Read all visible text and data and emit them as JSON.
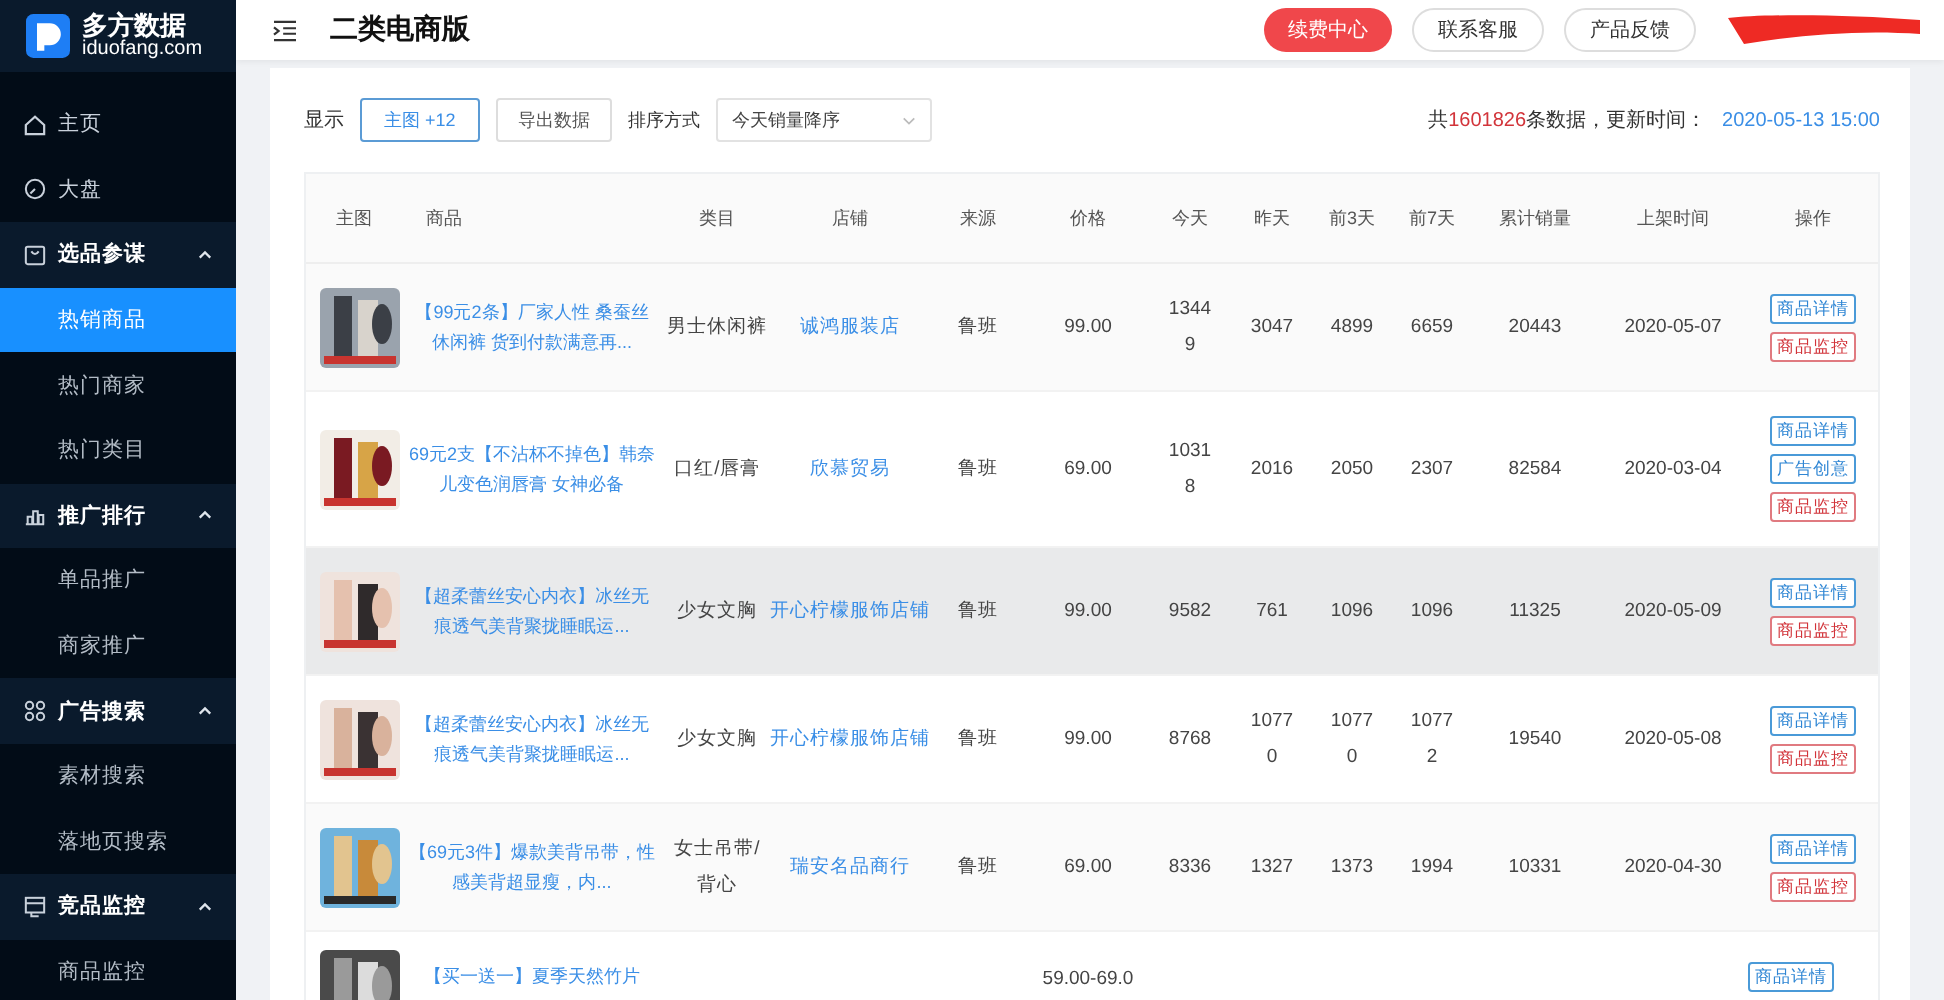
{
  "logo": {
    "name": "多方数据",
    "domain": "iduofang.com"
  },
  "header": {
    "title": "二类电商版",
    "buttons": [
      {
        "label": "续费中心",
        "kind": "primary"
      },
      {
        "label": "联系客服",
        "kind": "plain"
      },
      {
        "label": "产品反馈",
        "kind": "plain"
      }
    ]
  },
  "sidebar": {
    "items": [
      {
        "label": "主页",
        "selected": false
      },
      {
        "label": "大盘",
        "selected": false
      },
      {
        "label": "选品参谋",
        "expanded": true,
        "children": [
          {
            "label": "热销商品",
            "selected": true
          },
          {
            "label": "热门商家",
            "selected": false
          },
          {
            "label": "热门类目",
            "selected": false
          }
        ]
      },
      {
        "label": "推广排行",
        "expanded": true,
        "children": [
          {
            "label": "单品推广",
            "selected": false
          },
          {
            "label": "商家推广",
            "selected": false
          }
        ]
      },
      {
        "label": "广告搜索",
        "expanded": true,
        "children": [
          {
            "label": "素材搜索",
            "selected": false
          },
          {
            "label": "落地页搜索",
            "selected": false
          }
        ]
      },
      {
        "label": "竞品监控",
        "expanded": true,
        "children": [
          {
            "label": "商品监控",
            "selected": false
          }
        ]
      }
    ]
  },
  "toolbar": {
    "show_label": "显示",
    "columns_button": "主图 +12",
    "export_button": "导出数据",
    "sort_label": "排序方式",
    "sort": {
      "value": "今天销量降序"
    },
    "count_prefix": "共",
    "count": "1601826",
    "count_suffix": "条数据，更新时间：",
    "updated": "2020-05-13 15:00"
  },
  "table": {
    "columns": [
      "主图",
      "商品",
      "类目",
      "店铺",
      "来源",
      "价格",
      "今天",
      "昨天",
      "前3天",
      "前7天",
      "累计销量",
      "上架时间",
      "操作"
    ],
    "rows": [
      {
        "thumb": {
          "kind": "picture"
        },
        "highlighted": false,
        "product": "【99元2条】厂家人性 桑蚕丝休闲裤 货到付款满意再...",
        "category": "男士休闲裤",
        "store": "诚鸿服装店",
        "source": "鲁班",
        "price": "99.00",
        "today": "13449",
        "yesterday": "3047",
        "days3": "4899",
        "days7": "6659",
        "total": "20443",
        "listed": "2020-05-07",
        "actions": [
          {
            "label": "商品详情",
            "kind": "detail"
          },
          {
            "label": "商品监控",
            "kind": "monitor"
          }
        ]
      },
      {
        "thumb": {
          "kind": "picture"
        },
        "highlighted": false,
        "product": "69元2支【不沾杯不掉色】韩奈儿变色润唇膏 女神必备",
        "category": "口红/唇膏",
        "store": "欣慕贸易",
        "source": "鲁班",
        "price": "69.00",
        "today": "10318",
        "yesterday": "2016",
        "days3": "2050",
        "days7": "2307",
        "total": "82584",
        "listed": "2020-03-04",
        "actions": [
          {
            "label": "商品详情",
            "kind": "detail"
          },
          {
            "label": "广告创意",
            "kind": "detail"
          },
          {
            "label": "商品监控",
            "kind": "monitor"
          }
        ]
      },
      {
        "thumb": {
          "kind": "picture"
        },
        "highlighted": true,
        "product": "【超柔蕾丝安心内衣】冰丝无痕透气美背聚拢睡眠运...",
        "category": "少女文胸",
        "store": "开心柠檬服饰店铺",
        "source": "鲁班",
        "price": "99.00",
        "today": "9582",
        "yesterday": "761",
        "days3": "1096",
        "days7": "1096",
        "total": "11325",
        "listed": "2020-05-09",
        "actions": [
          {
            "label": "商品详情",
            "kind": "detail"
          },
          {
            "label": "商品监控",
            "kind": "monitor"
          }
        ]
      },
      {
        "thumb": {
          "kind": "picture"
        },
        "highlighted": false,
        "product": "【超柔蕾丝安心内衣】冰丝无痕透气美背聚拢睡眠运...",
        "category": "少女文胸",
        "store": "开心柠檬服饰店铺",
        "source": "鲁班",
        "price": "99.00",
        "today": "8768",
        "yesterday": "10770",
        "days3": "10770",
        "days7": "10772",
        "total": "19540",
        "listed": "2020-05-08",
        "actions": [
          {
            "label": "商品详情",
            "kind": "detail"
          },
          {
            "label": "商品监控",
            "kind": "monitor"
          }
        ]
      },
      {
        "thumb": {
          "kind": "picture"
        },
        "highlighted": false,
        "product": "【69元3件】爆款美背吊带，性感美背超显瘦，内...",
        "category": "女士吊带/背心",
        "store": "瑞安名品商行",
        "source": "鲁班",
        "price": "69.00",
        "today": "8336",
        "yesterday": "1327",
        "days3": "1373",
        "days7": "1994",
        "total": "10331",
        "listed": "2020-04-30",
        "actions": [
          {
            "label": "商品详情",
            "kind": "detail"
          },
          {
            "label": "商品监控",
            "kind": "monitor"
          }
        ]
      },
      {
        "thumb": {
          "kind": "picture"
        },
        "highlighted": false,
        "product": "【买一送一】夏季天然竹片",
        "price": "59.00-69.0",
        "actions": [
          {
            "label": "商品详情",
            "kind": "detail"
          }
        ]
      }
    ]
  }
}
